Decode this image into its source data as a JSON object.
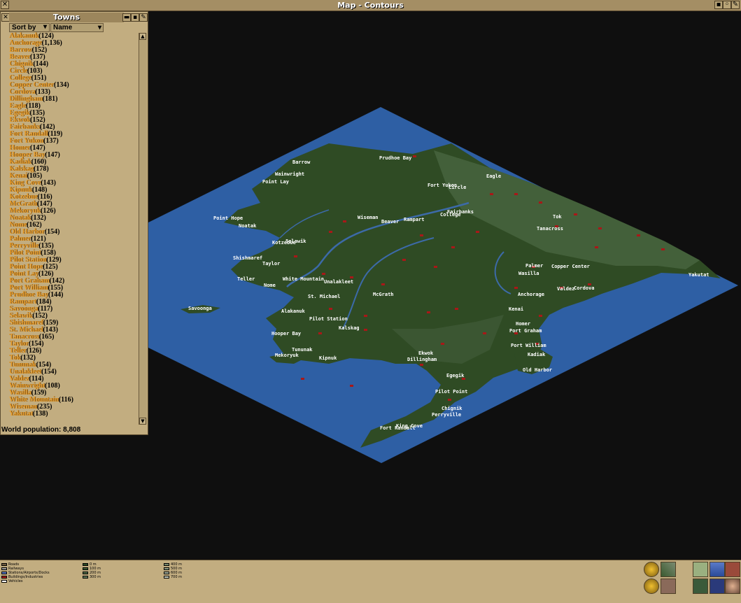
{
  "window": {
    "title": "Map - Contours",
    "close_icon": "close-icon"
  },
  "towns_panel": {
    "title": "Towns",
    "sort_label": "Sort by",
    "sort_value": "Name",
    "world_population": "World population: 8,808",
    "towns": [
      {
        "name": "Alakanuk",
        "pop": "(124)"
      },
      {
        "name": "Anchorage",
        "pop": "(1,136)"
      },
      {
        "name": "Barrow",
        "pop": "(152)"
      },
      {
        "name": "Beaver",
        "pop": "(137)"
      },
      {
        "name": "Chignik",
        "pop": "(144)"
      },
      {
        "name": "Circle",
        "pop": "(103)"
      },
      {
        "name": "College",
        "pop": "(151)"
      },
      {
        "name": "Copper Center",
        "pop": "(134)"
      },
      {
        "name": "Cordova",
        "pop": "(133)"
      },
      {
        "name": "Dillingham",
        "pop": "(181)"
      },
      {
        "name": "Eagle",
        "pop": "(118)"
      },
      {
        "name": "Egegik",
        "pop": "(135)"
      },
      {
        "name": "Ekwok",
        "pop": "(152)"
      },
      {
        "name": "Fairbanks",
        "pop": "(142)"
      },
      {
        "name": "Fort Randall",
        "pop": "(119)"
      },
      {
        "name": "Fort Yukon",
        "pop": "(137)"
      },
      {
        "name": "Homer",
        "pop": "(147)"
      },
      {
        "name": "Hooper Bay",
        "pop": "(147)"
      },
      {
        "name": "Kadiak",
        "pop": "(160)"
      },
      {
        "name": "Kalskag",
        "pop": "(178)"
      },
      {
        "name": "Kenai",
        "pop": "(105)"
      },
      {
        "name": "King Cove",
        "pop": "(143)"
      },
      {
        "name": "Kipnuk",
        "pop": "(148)"
      },
      {
        "name": "Kotzebue",
        "pop": "(116)"
      },
      {
        "name": "McGrath",
        "pop": "(147)"
      },
      {
        "name": "Mekoryuk",
        "pop": "(126)"
      },
      {
        "name": "Noatak",
        "pop": "(132)"
      },
      {
        "name": "Nome",
        "pop": "(162)"
      },
      {
        "name": "Old Harbor",
        "pop": "(154)"
      },
      {
        "name": "Palmer",
        "pop": "(121)"
      },
      {
        "name": "Perryville",
        "pop": "(135)"
      },
      {
        "name": "Pilot Point",
        "pop": "(158)"
      },
      {
        "name": "Pilot Station",
        "pop": "(129)"
      },
      {
        "name": "Point Hope",
        "pop": "(125)"
      },
      {
        "name": "Point Lay",
        "pop": "(126)"
      },
      {
        "name": "Port Graham",
        "pop": "(142)"
      },
      {
        "name": "Port William",
        "pop": "(155)"
      },
      {
        "name": "Prudhoe Bay",
        "pop": "(144)"
      },
      {
        "name": "Rampart",
        "pop": "(184)"
      },
      {
        "name": "Savoonga",
        "pop": "(117)"
      },
      {
        "name": "Selawik",
        "pop": "(152)"
      },
      {
        "name": "Shishmaref",
        "pop": "(159)"
      },
      {
        "name": "St. Michael",
        "pop": "(143)"
      },
      {
        "name": "Tanacross",
        "pop": "(165)"
      },
      {
        "name": "Taylor",
        "pop": "(154)"
      },
      {
        "name": "Teller",
        "pop": "(126)"
      },
      {
        "name": "Tok",
        "pop": "(132)"
      },
      {
        "name": "Tununak",
        "pop": "(154)"
      },
      {
        "name": "Unalakleet",
        "pop": "(154)"
      },
      {
        "name": "Valdez",
        "pop": "(114)"
      },
      {
        "name": "Wainwright",
        "pop": "(108)"
      },
      {
        "name": "Wasilla",
        "pop": "(159)"
      },
      {
        "name": "White Mountain",
        "pop": "(116)"
      },
      {
        "name": "Wiseman",
        "pop": "(235)"
      },
      {
        "name": "Yakutat",
        "pop": "(138)"
      }
    ]
  },
  "map_labels": [
    "Prudhoe Bay",
    "Barrow",
    "Wainwright",
    "Point Lay",
    "Eagle",
    "Fort Yukon",
    "Circle",
    "Fairbanks",
    "College",
    "Point Hope",
    "Noatak",
    "Wiseman",
    "Beaver",
    "Rampart",
    "Tok",
    "Tanacross",
    "Kotzebue",
    "Selawik",
    "Shishmaref",
    "Taylor",
    "Teller",
    "Nome",
    "White Mountain",
    "Unalakleet",
    "St. Michael",
    "McGrath",
    "Palmer",
    "Copper Center",
    "Wasilla",
    "Anchorage",
    "Valdez",
    "Cordova",
    "Yakutat",
    "Savoonga",
    "Alakanuk",
    "Pilot Station",
    "Kalskag",
    "Kenai",
    "Homer",
    "Port Graham",
    "Hooper Bay",
    "Tununak",
    "Mekoryuk",
    "Kipnuk",
    "Ekwok",
    "Dillingham",
    "Port William",
    "Kadiak",
    "Old Harbor",
    "Egegik",
    "Pilot Point",
    "Chignik",
    "Perryville",
    "King Cove",
    "Fort Randall"
  ],
  "legend": {
    "left": [
      {
        "label": "Roads",
        "color": "#6e5b3c"
      },
      {
        "label": "Railways",
        "color": "#9a9a9a"
      },
      {
        "label": "Stations/Airports/Docks",
        "color": "#5a78c8"
      },
      {
        "label": "Buildings/Industries",
        "color": "#b01818"
      },
      {
        "label": "Vehicles",
        "color": "#ffffff"
      }
    ],
    "mid": [
      {
        "label": "0 m",
        "color": "#2c4a24"
      },
      {
        "label": "100 m",
        "color": "#3a5a30"
      },
      {
        "label": "200 m",
        "color": "#4e6a44"
      },
      {
        "label": "300 m",
        "color": "#627a58"
      }
    ],
    "right": [
      {
        "label": "400 m",
        "color": "#76886c"
      },
      {
        "label": "500 m",
        "color": "#8a9a82"
      },
      {
        "label": "600 m",
        "color": "#a2ae9c"
      },
      {
        "label": "700 m",
        "color": "#c4ccc0"
      }
    ]
  },
  "toolbar": [
    "zoom-in-icon",
    "terrain-icon",
    "contours-icon",
    "vegetation-icon",
    "owner-icon",
    "zoom-out-icon",
    "industry-icon",
    "routes-icon",
    "vehicles-icon",
    "owner-face-icon"
  ]
}
